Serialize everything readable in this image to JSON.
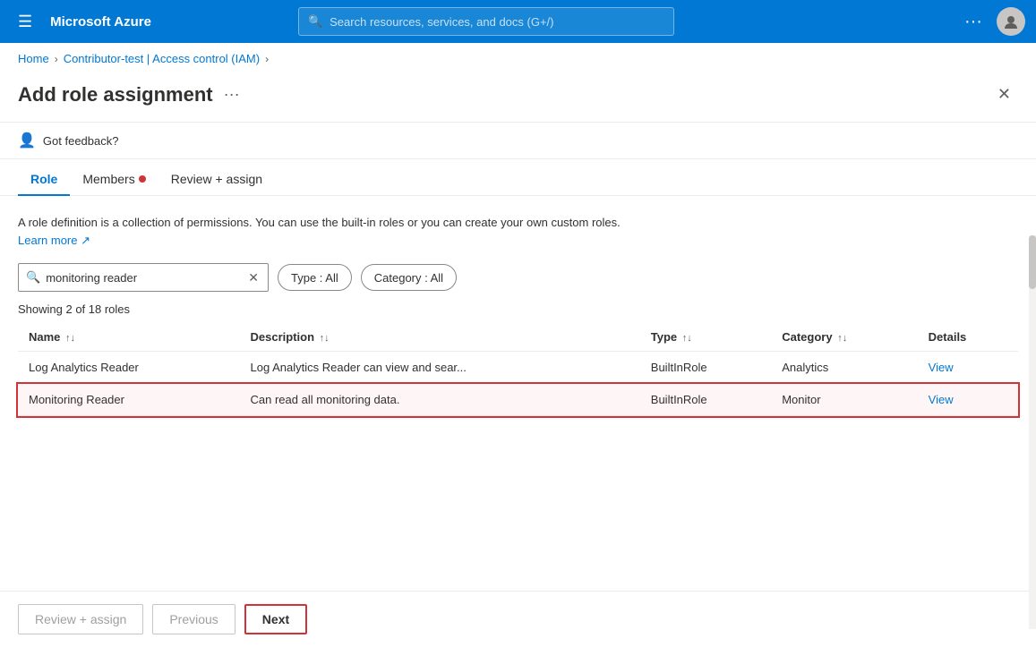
{
  "topnav": {
    "title": "Microsoft Azure",
    "search_placeholder": "Search resources, services, and docs (G+/)",
    "dots_label": "···"
  },
  "breadcrumb": {
    "items": [
      {
        "label": "Home",
        "href": "#"
      },
      {
        "label": "Contributor-test | Access control (IAM)",
        "href": "#"
      }
    ]
  },
  "page": {
    "title": "Add role assignment",
    "dots": "···"
  },
  "feedback": {
    "text": "Got feedback?"
  },
  "tabs": [
    {
      "id": "role",
      "label": "Role",
      "active": true,
      "dot": false
    },
    {
      "id": "members",
      "label": "Members",
      "active": false,
      "dot": true
    },
    {
      "id": "review",
      "label": "Review + assign",
      "active": false,
      "dot": false
    }
  ],
  "description": {
    "text": "A role definition is a collection of permissions. You can use the built-in roles or you can create your own custom roles.",
    "link_label": "Learn more",
    "link_icon": "↗"
  },
  "filters": {
    "search_value": "monitoring reader",
    "search_placeholder": "Search by role name",
    "type_label": "Type : All",
    "category_label": "Category : All"
  },
  "showing": {
    "text": "Showing 2 of 18 roles"
  },
  "table": {
    "columns": [
      {
        "label": "Name",
        "sort": "↑↓"
      },
      {
        "label": "Description",
        "sort": "↑↓"
      },
      {
        "label": "Type",
        "sort": "↑↓"
      },
      {
        "label": "Category",
        "sort": "↑↓"
      },
      {
        "label": "Details",
        "sort": ""
      }
    ],
    "rows": [
      {
        "name": "Log Analytics Reader",
        "description": "Log Analytics Reader can view and sear...",
        "type": "BuiltInRole",
        "category": "Analytics",
        "details": "View",
        "selected": false
      },
      {
        "name": "Monitoring Reader",
        "description": "Can read all monitoring data.",
        "type": "BuiltInRole",
        "category": "Monitor",
        "details": "View",
        "selected": true
      }
    ]
  },
  "footer": {
    "review_assign_label": "Review + assign",
    "previous_label": "Previous",
    "next_label": "Next"
  }
}
